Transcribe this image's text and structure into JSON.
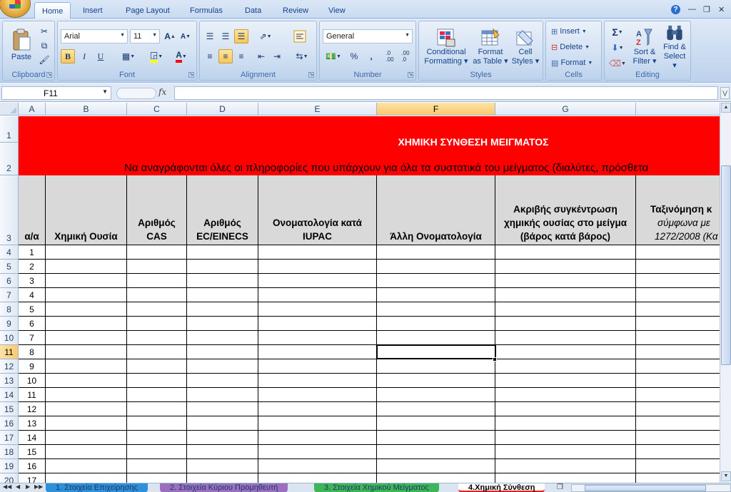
{
  "ribbon_tabs": [
    "Home",
    "Insert",
    "Page Layout",
    "Formulas",
    "Data",
    "Review",
    "View"
  ],
  "active_tab": "Home",
  "clipboard": {
    "paste": "Paste",
    "title": "Clipboard"
  },
  "font": {
    "name": "Arial",
    "size": "11",
    "title": "Font",
    "bold": "B",
    "italic": "I",
    "underline": "U"
  },
  "alignment": {
    "title": "Alignment"
  },
  "number": {
    "format": "General",
    "title": "Number",
    "percent": "%",
    "comma": ",",
    "inc_dec": ".0→.00",
    "dec_dec": ".00→.0"
  },
  "styles": {
    "title": "Styles",
    "conditional_1": "Conditional",
    "conditional_2": "Formatting",
    "format_table_1": "Format",
    "format_table_2": "as Table",
    "cell_styles_1": "Cell",
    "cell_styles_2": "Styles"
  },
  "cells": {
    "title": "Cells",
    "insert": "Insert",
    "delete": "Delete",
    "format": "Format"
  },
  "editing": {
    "title": "Editing",
    "sigma": "Σ",
    "sort_1": "Sort &",
    "sort_2": "Filter",
    "find_1": "Find &",
    "find_2": "Select"
  },
  "formula_bar": {
    "name_box": "F11",
    "fx": "fx",
    "value": ""
  },
  "columns": [
    "A",
    "B",
    "C",
    "D",
    "E",
    "F",
    "G"
  ],
  "selected_column": "F",
  "selected_row": "11",
  "sheet": {
    "title": "ΧΗΜΙΚΗ ΣΥΝΘΕΣΗ ΜΕΙΓΜΑΤΟΣ",
    "subtitle": "Να αναγράφονται όλες οι πληροφορίες που υπάρχουν για όλα τα συστατικά του μείγματος (διαλύτες, πρόσθετα",
    "headers": {
      "a": "α/α",
      "b": "Χημική  Ουσία",
      "c1": "Αριθμός",
      "c2": "CAS",
      "d1": "Αριθμός",
      "d2": "EC/EINECS",
      "e1": "Ονοματολογία κατά",
      "e2": "IUPAC",
      "f": "Άλλη Ονοματολογία",
      "g1": "Ακριβής συγκέντρωση",
      "g2": "χημικής ουσίας στο μείγμα",
      "g3": "(βάρος κατά βάρος)",
      "h1": "Ταξινόμηση κ",
      "h2": "σύμφωνα με",
      "h3": "1272/2008 (Κα"
    },
    "row_numbers": [
      "1",
      "2",
      "3",
      "4",
      "5",
      "6",
      "7",
      "8",
      "9",
      "10",
      "11",
      "12",
      "13",
      "14",
      "15",
      "16",
      "17",
      "18",
      "19",
      "20"
    ],
    "aa_values": [
      "1",
      "2",
      "3",
      "4",
      "5",
      "6",
      "7",
      "8",
      "9",
      "10",
      "11",
      "12",
      "13",
      "14",
      "15",
      "16",
      "17"
    ]
  },
  "sheet_tabs": [
    {
      "label": "1. Στοιχεία Επιχείρησης",
      "color": "#2f8fd8"
    },
    {
      "label": "2. Στοιχεία Κύριου Προμηθευτή",
      "color": "#9a6fc0"
    },
    {
      "label": "3. Στοιχεία Χημικού Μείγματος",
      "color": "#3fb55a"
    },
    {
      "label": "4.Χημική Σύνθεση",
      "color": "#e11f1f"
    }
  ],
  "colors": {
    "title_band": "#ff0000",
    "header_fill": "#d9d9d9",
    "selection": "#f9c96e"
  }
}
